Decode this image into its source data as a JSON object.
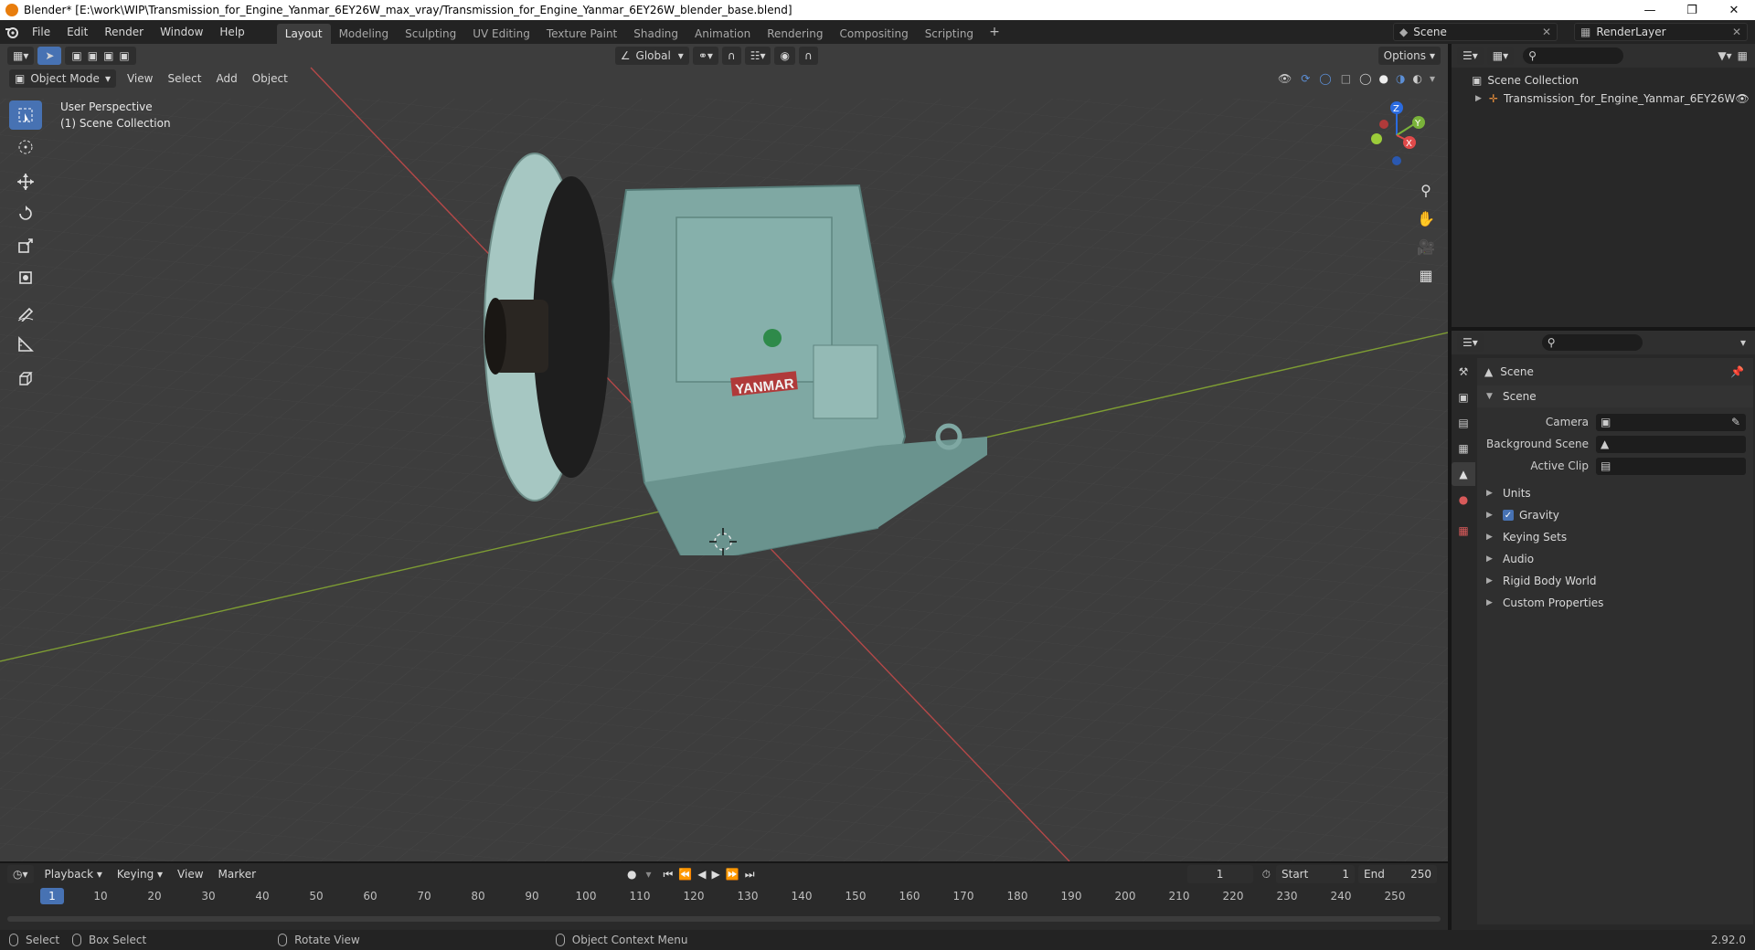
{
  "window": {
    "title": "Blender* [E:\\work\\WIP\\Transmission_for_Engine_Yanmar_6EY26W_max_vray/Transmission_for_Engine_Yanmar_6EY26W_blender_base.blend]"
  },
  "menu": [
    "File",
    "Edit",
    "Render",
    "Window",
    "Help"
  ],
  "workspaces": [
    "Layout",
    "Modeling",
    "Sculpting",
    "UV Editing",
    "Texture Paint",
    "Shading",
    "Animation",
    "Rendering",
    "Compositing",
    "Scripting"
  ],
  "active_workspace": "Layout",
  "scene_name": "Scene",
  "view_layer": "RenderLayer",
  "viewport": {
    "transform_orientation": "Global",
    "options_label": "Options",
    "mode": "Object Mode",
    "header_menus": [
      "View",
      "Select",
      "Add",
      "Object"
    ],
    "info_line1": "User Perspective",
    "info_line2": "(1) Scene Collection",
    "axes": {
      "x": "X",
      "y": "Y",
      "z": "Z"
    },
    "model_brand": "YANMAR"
  },
  "timeline": {
    "menus": [
      "Playback",
      "Keying",
      "View",
      "Marker"
    ],
    "current_frame": "1",
    "start_label": "Start",
    "start": "1",
    "end_label": "End",
    "end": "250",
    "ticks": [
      "1",
      "10",
      "20",
      "30",
      "40",
      "50",
      "60",
      "70",
      "80",
      "90",
      "100",
      "110",
      "120",
      "130",
      "140",
      "150",
      "160",
      "170",
      "180",
      "190",
      "200",
      "210",
      "220",
      "230",
      "240",
      "250"
    ]
  },
  "status": {
    "select": "Select",
    "box_select": "Box Select",
    "rotate": "Rotate View",
    "context": "Object Context Menu",
    "version": "2.92.0"
  },
  "outliner": {
    "root": "Scene Collection",
    "object": "Transmission_for_Engine_Yanmar_6EY26W"
  },
  "properties": {
    "context": "Scene",
    "panel": "Scene",
    "camera_label": "Camera",
    "bg_scene_label": "Background Scene",
    "clip_label": "Active Clip",
    "subpanels": [
      "Units",
      "Gravity",
      "Keying Sets",
      "Audio",
      "Rigid Body World",
      "Custom Properties"
    ]
  },
  "colors": {
    "accent": "#4772b3",
    "model": "#7fa8a3",
    "grid_x": "#c04848",
    "grid_y": "#7e9d33"
  }
}
